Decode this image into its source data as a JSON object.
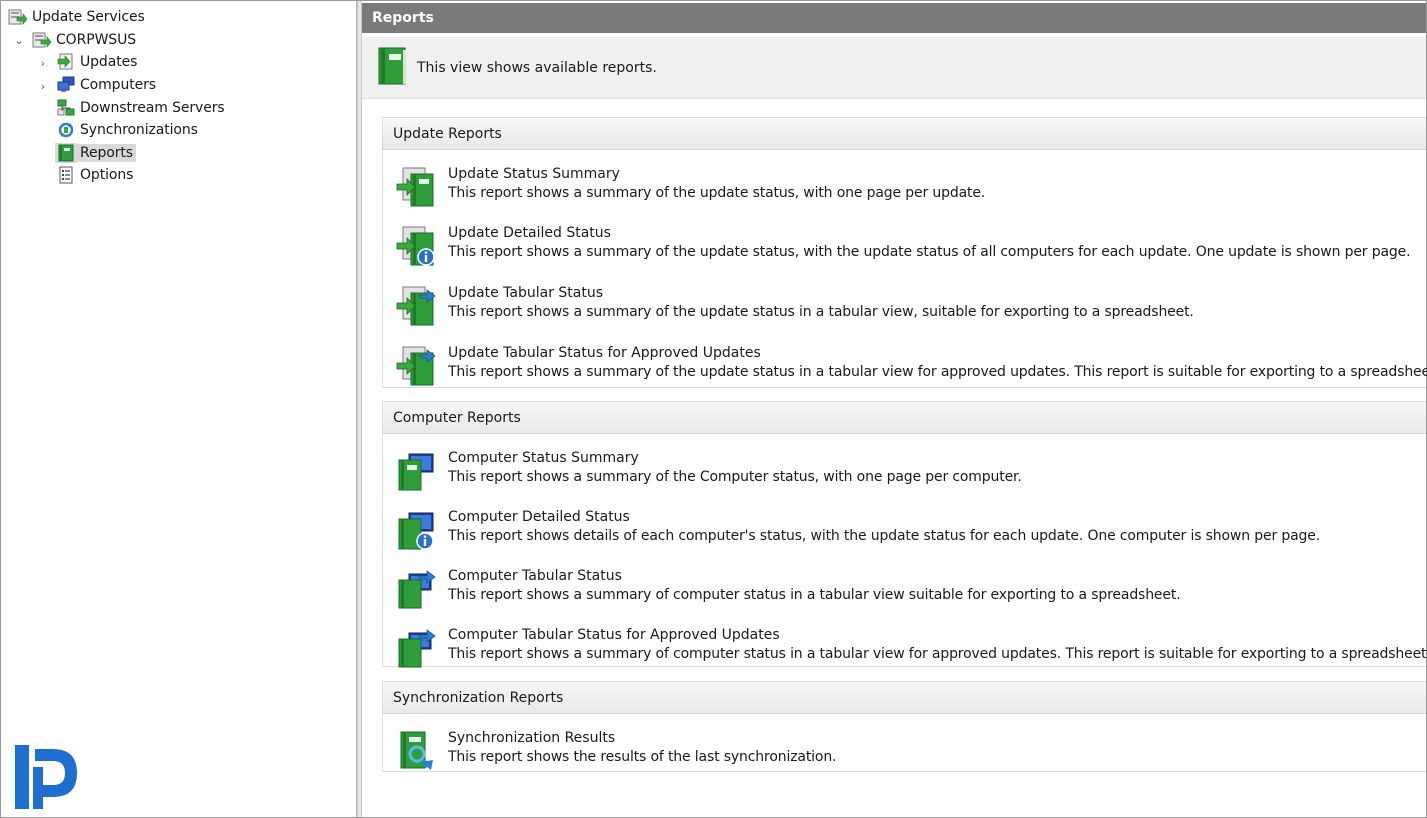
{
  "tree": {
    "root": "Update Services",
    "server": "CORPWSUS",
    "items": [
      {
        "label": "Updates",
        "icon": "updates-icon"
      },
      {
        "label": "Computers",
        "icon": "computers-icon"
      },
      {
        "label": "Downstream Servers",
        "icon": "downstream-servers-icon"
      },
      {
        "label": "Synchronizations",
        "icon": "synchronizations-icon"
      },
      {
        "label": "Reports",
        "icon": "reports-icon",
        "selected": true
      },
      {
        "label": "Options",
        "icon": "options-icon"
      }
    ]
  },
  "main": {
    "title": "Reports",
    "info": "This view shows available reports.",
    "sections": [
      {
        "header": "Update Reports",
        "reports": [
          {
            "title": "Update Status Summary",
            "desc": "This report shows a summary of the update status, with one page per update."
          },
          {
            "title": "Update Detailed Status",
            "desc": "This report shows a summary of the update status, with the update status of all computers for each update. One update is shown per page."
          },
          {
            "title": "Update Tabular Status",
            "desc": "This report shows a summary of the update status in a tabular view, suitable for exporting to a spreadsheet."
          },
          {
            "title": "Update Tabular Status for Approved Updates",
            "desc": "This report shows a summary of the update status in a tabular view for approved updates. This report is suitable for exporting to a spreadsheet."
          }
        ]
      },
      {
        "header": "Computer Reports",
        "reports": [
          {
            "title": "Computer Status Summary",
            "desc": "This report shows a summary of the Computer status, with one page per computer."
          },
          {
            "title": "Computer Detailed Status",
            "desc": "This report shows details of each computer's status, with the update status for each update. One computer is shown per page."
          },
          {
            "title": "Computer Tabular Status",
            "desc": "This report shows a summary of computer status in a tabular view suitable for exporting to a spreadsheet."
          },
          {
            "title": "Computer Tabular Status for Approved Updates",
            "desc": "This report shows a summary of computer status in a tabular view for approved updates. This report is suitable for exporting to a spreadsheet."
          }
        ]
      },
      {
        "header": "Synchronization Reports",
        "reports": [
          {
            "title": "Synchronization Results",
            "desc": "This report shows the results of the last synchronization."
          }
        ]
      }
    ]
  },
  "colors": {
    "title_bar": "#7a7a7a",
    "info_bar": "#f0f0f0",
    "book_green": "#2f9e3a",
    "arrow_blue": "#2a7fd4",
    "brand_blue": "#1e6fd0"
  }
}
